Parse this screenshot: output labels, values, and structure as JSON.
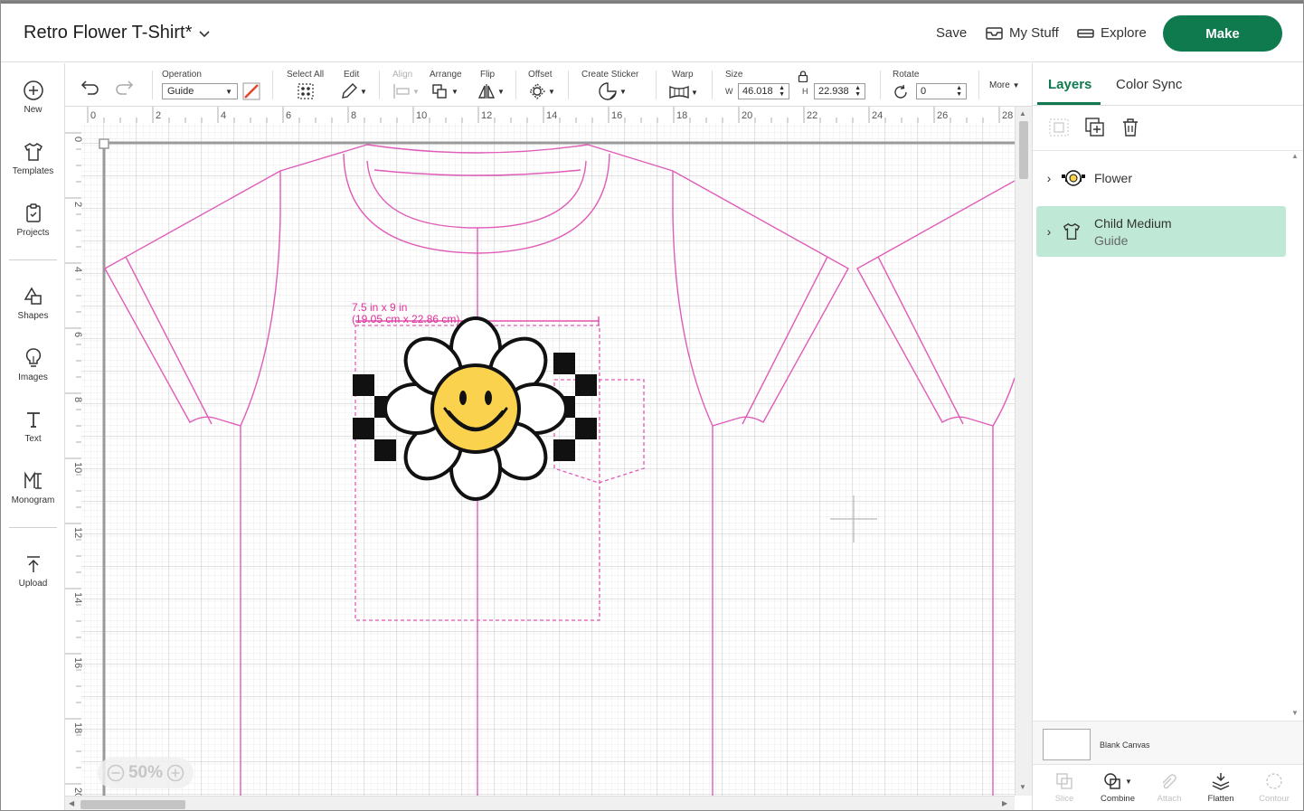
{
  "header": {
    "project_title": "Retro Flower T-Shirt*",
    "save_label": "Save",
    "my_stuff_label": "My Stuff",
    "explore_label": "Explore",
    "make_label": "Make"
  },
  "leftnav": {
    "items": [
      {
        "label": "New",
        "icon": "plus-circle-icon"
      },
      {
        "label": "Templates",
        "icon": "tshirt-icon"
      },
      {
        "label": "Projects",
        "icon": "clipboard-icon"
      },
      {
        "label": "Shapes",
        "icon": "shapes-icon"
      },
      {
        "label": "Images",
        "icon": "lightbulb-icon"
      },
      {
        "label": "Text",
        "icon": "text-icon"
      },
      {
        "label": "Monogram",
        "icon": "monogram-icon"
      },
      {
        "label": "Upload",
        "icon": "upload-icon"
      }
    ]
  },
  "toolbar": {
    "operation_label": "Operation",
    "operation_value": "Guide",
    "select_all_label": "Select All",
    "edit_label": "Edit",
    "align_label": "Align",
    "arrange_label": "Arrange",
    "flip_label": "Flip",
    "offset_label": "Offset",
    "create_sticker_label": "Create Sticker",
    "warp_label": "Warp",
    "size_label": "Size",
    "width_prefix": "W",
    "width_value": "46.018",
    "height_prefix": "H",
    "height_value": "22.938",
    "rotate_label": "Rotate",
    "rotate_value": "0",
    "more_label": "More"
  },
  "canvas": {
    "ruler_top": [
      "0",
      "2",
      "4",
      "6",
      "8",
      "10",
      "12",
      "14",
      "16",
      "18",
      "20",
      "22",
      "24",
      "26",
      "28"
    ],
    "ruler_left": [
      "0",
      "2",
      "4",
      "6",
      "8",
      "10",
      "12",
      "14",
      "16",
      "18",
      "20"
    ],
    "dimension_in": "7.5 in x 9 in",
    "dimension_cm": "(19.05 cm x 22.86 cm)",
    "zoom_value": "50%",
    "guide_color": "#e0309e",
    "flower_color": "#fbd24e"
  },
  "right_panel": {
    "tab_layers": "Layers",
    "tab_color_sync": "Color Sync",
    "layers": [
      {
        "name": "Flower",
        "sub": ""
      },
      {
        "name": "Child Medium",
        "sub": "Guide"
      }
    ],
    "blank_canvas_label": "Blank Canvas",
    "bottom_tools": [
      {
        "label": "Slice",
        "enabled": false
      },
      {
        "label": "Combine",
        "enabled": true
      },
      {
        "label": "Attach",
        "enabled": false
      },
      {
        "label": "Flatten",
        "enabled": true
      },
      {
        "label": "Contour",
        "enabled": false
      }
    ]
  },
  "colors": {
    "brand_green": "#0f7a4d",
    "selected_layer_bg": "#bfe9d6"
  }
}
